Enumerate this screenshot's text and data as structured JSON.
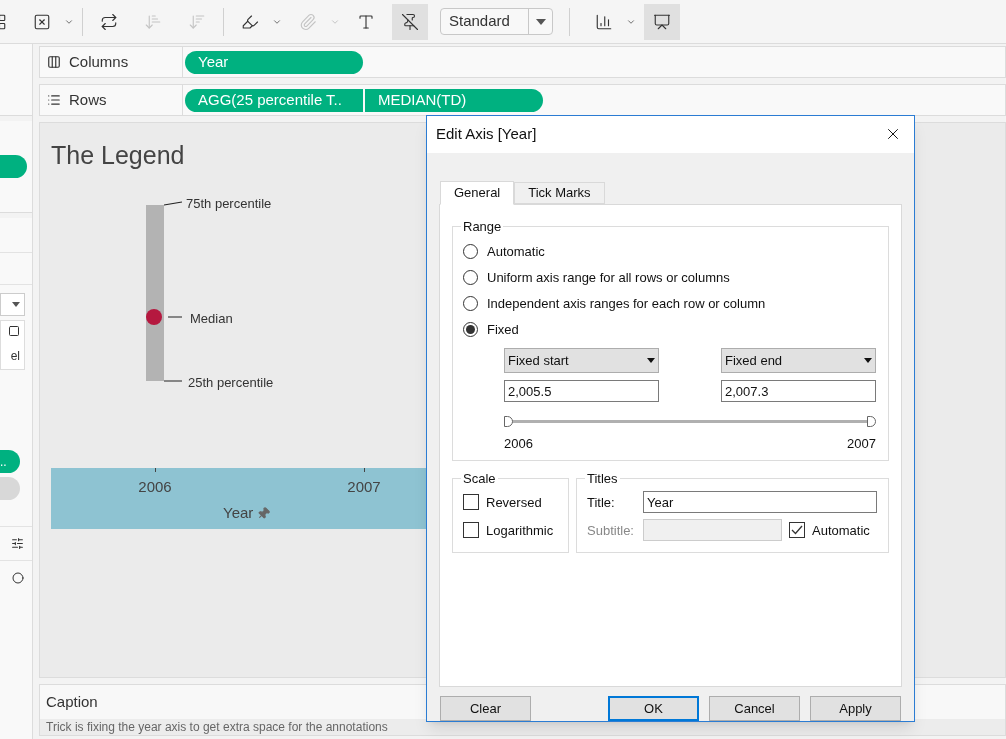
{
  "toolbar": {
    "buttons": [
      {
        "kind": "partial",
        "selected": false
      },
      {
        "kind": "clear-sheet",
        "selected": false,
        "disabled": false,
        "menu": true
      },
      {
        "kind": "swap",
        "selected": false
      },
      {
        "kind": "sort-asc",
        "selected": false,
        "disabled": true
      },
      {
        "kind": "sort-desc",
        "selected": false,
        "disabled": true
      },
      {
        "kind": "highlight",
        "selected": false,
        "disabled": false,
        "menu": true
      },
      {
        "kind": "attach",
        "selected": false,
        "disabled": true,
        "menu": true
      },
      {
        "kind": "text",
        "selected": false
      },
      {
        "kind": "pin",
        "selected": true
      }
    ],
    "fit": "Standard",
    "end_buttons": [
      {
        "kind": "show-me",
        "selected": false,
        "menu": true
      },
      {
        "kind": "presentation",
        "selected": true
      }
    ]
  },
  "shelves": [
    {
      "label": "Columns",
      "kind": "columns",
      "pills": [
        "Year"
      ]
    },
    {
      "label": "Rows",
      "kind": "rows",
      "pills": [
        "AGG(25 percentile T..",
        "MEDIAN(TD)"
      ]
    }
  ],
  "sidebar": {
    "label_fragment": "el",
    "pill_fragment": ".."
  },
  "view": {
    "title": "The Legend",
    "annotations": [
      "75th percentile",
      "Median",
      "25th percentile"
    ],
    "axis": {
      "ticks": [
        "2006",
        "2007"
      ],
      "title": "Year"
    }
  },
  "caption": {
    "header": "Caption",
    "text": "Trick is fixing the year axis to get extra space for the annotations"
  },
  "dialog": {
    "title": "Edit Axis [Year]",
    "tabs": [
      {
        "label": "General",
        "selected": true
      },
      {
        "label": "Tick Marks",
        "selected": false
      }
    ],
    "range": {
      "label": "Range",
      "options": [
        {
          "label": "Automatic",
          "selected": false
        },
        {
          "label": "Uniform axis range for all rows or columns",
          "selected": false
        },
        {
          "label": "Independent axis ranges for each row or column",
          "selected": false
        },
        {
          "label": "Fixed",
          "selected": true
        }
      ],
      "thumbs": [
        {
          "level": 0
        },
        {
          "level": 1
        }
      ],
      "start": {
        "mode": "Fixed start",
        "value": "2,005.5"
      },
      "end": {
        "mode": "Fixed end",
        "value": "2,007.3"
      },
      "slider_labels": [
        "2006",
        "2007"
      ]
    },
    "scale": {
      "label": "Scale",
      "options": [
        {
          "label": "Reversed",
          "checked": false
        },
        {
          "label": "Logarithmic",
          "checked": false
        }
      ]
    },
    "titles": {
      "label": "Titles",
      "title_label": "Title:",
      "title_value": "Year",
      "subtitle_label": "Subtitle:",
      "subtitle_disabled": true,
      "automatic": {
        "label": "Automatic",
        "checked": true
      }
    },
    "buttons": [
      {
        "label": "Clear",
        "default": false
      },
      {
        "label": "OK",
        "default": true
      },
      {
        "label": "Cancel",
        "default": false
      },
      {
        "label": "Apply",
        "default": false
      }
    ]
  }
}
